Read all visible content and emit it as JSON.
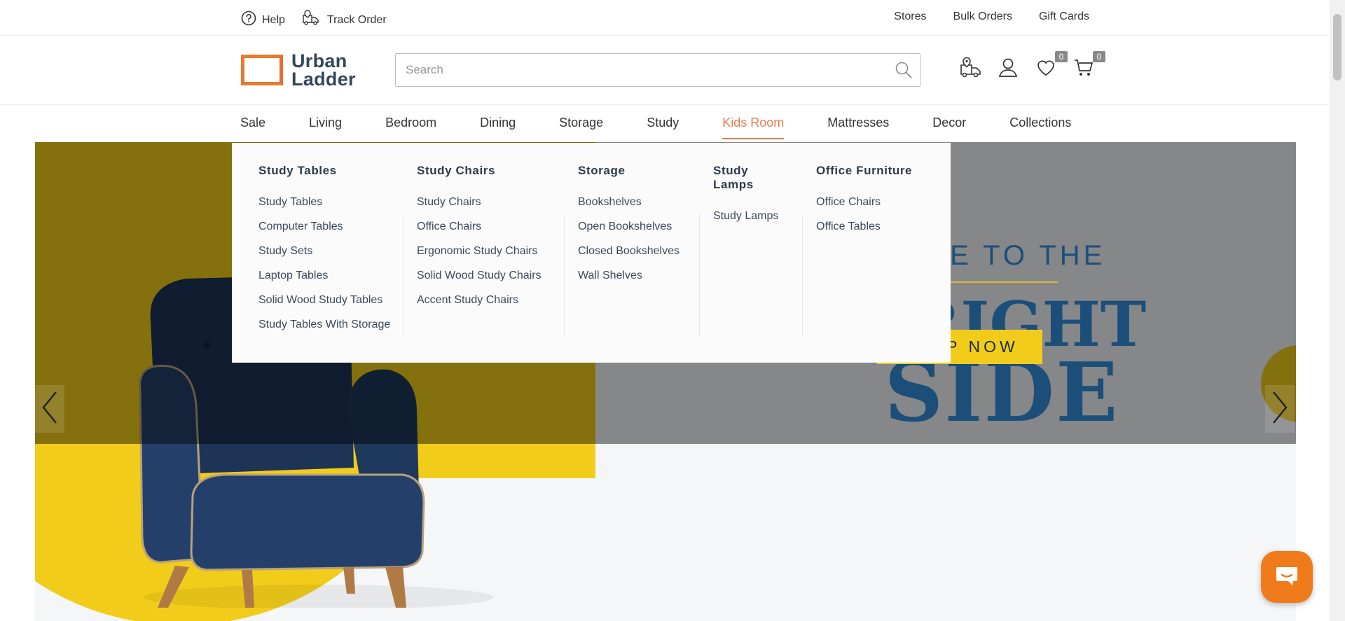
{
  "topbar": {
    "help_label": "Help",
    "track_order_label": "Track Order",
    "stores_label": "Stores",
    "bulk_orders_label": "Bulk Orders",
    "gift_cards_label": "Gift Cards"
  },
  "header": {
    "logo_line1": "Urban",
    "logo_line2": "Ladder",
    "search_placeholder": "Search",
    "wishlist_count": "0",
    "cart_count": "0"
  },
  "nav": {
    "items": [
      "Sale",
      "Living",
      "Bedroom",
      "Dining",
      "Storage",
      "Study",
      "Kids Room",
      "Mattresses",
      "Decor",
      "Collections"
    ],
    "active": "Kids Room"
  },
  "menu": {
    "columns": [
      {
        "heading": "Study Tables",
        "links": [
          "Study Tables",
          "Computer Tables",
          "Study Sets",
          "Laptop Tables",
          "Solid Wood Study Tables",
          "Study Tables With Storage"
        ]
      },
      {
        "heading": "Study Chairs",
        "links": [
          "Study Chairs",
          "Office Chairs",
          "Ergonomic Study Chairs",
          "Solid Wood Study Chairs",
          "Accent Study Chairs"
        ]
      },
      {
        "heading": "Storage",
        "links": [
          "Bookshelves",
          "Open Bookshelves",
          "Closed Bookshelves",
          "Wall Shelves"
        ]
      },
      {
        "heading": "Study Lamps",
        "links": [
          "Study Lamps"
        ]
      },
      {
        "heading": "Office Furniture",
        "links": [
          "Office Chairs",
          "Office Tables"
        ]
      }
    ]
  },
  "hero": {
    "welcome": "OME TO THE",
    "bright": "BRIGHT",
    "side": "SIDE",
    "shop_now": "SHOP NOW"
  },
  "colors": {
    "accent": "#e87a4f",
    "brand_orange": "#e87a2f",
    "yellow": "#f2cc1a",
    "navy": "#1b4f7a"
  },
  "icons": [
    "help-icon",
    "truck-icon",
    "search-icon",
    "location-truck-icon",
    "user-icon",
    "heart-icon",
    "cart-icon",
    "chevron-left-icon",
    "chevron-right-icon",
    "chat-icon"
  ]
}
